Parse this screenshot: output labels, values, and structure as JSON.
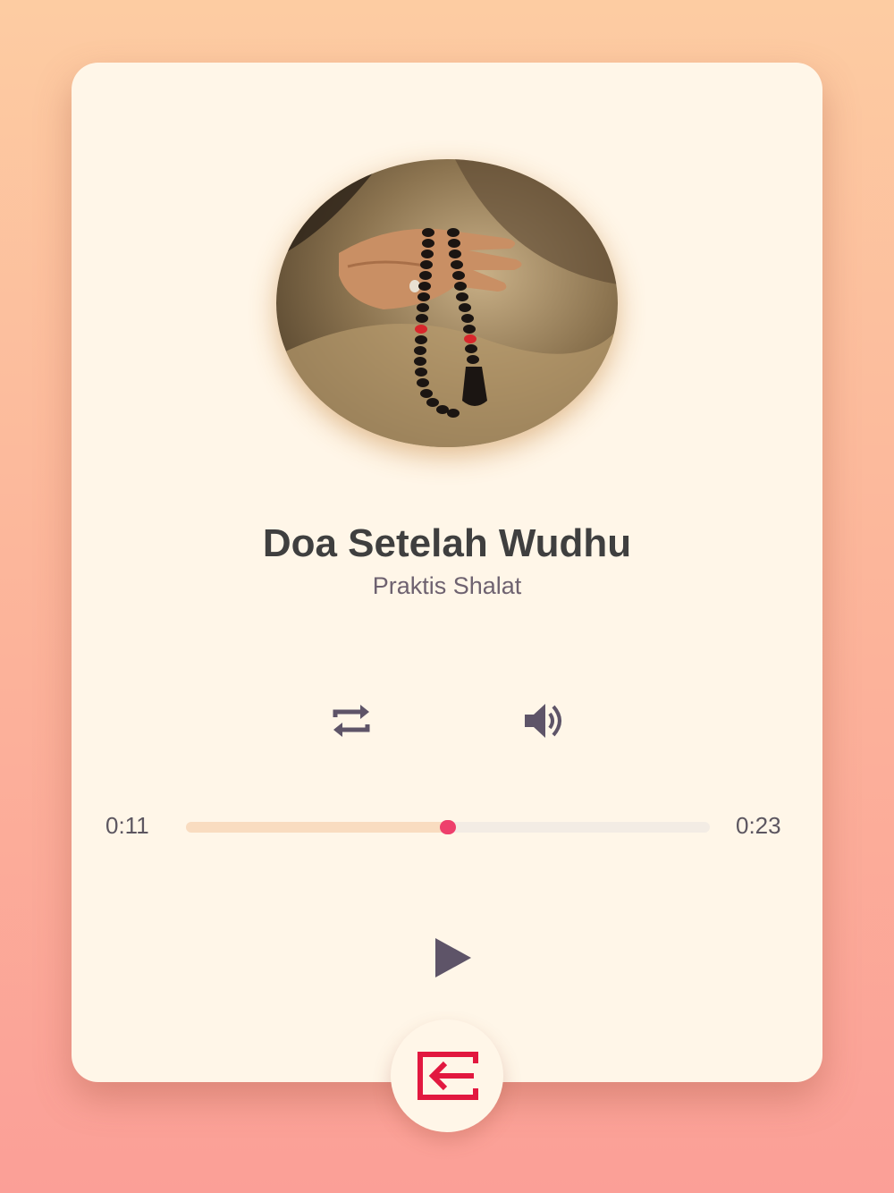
{
  "track": {
    "title": "Doa Setelah Wudhu",
    "artist": "Praktis Shalat",
    "artwork": "prayer-beads-hand-photo"
  },
  "controls": {
    "repeat_icon": "repeat-icon",
    "volume_icon": "volume-icon",
    "play_icon": "play-icon",
    "exit_icon": "exit-icon"
  },
  "progress": {
    "current_time": "0:11",
    "total_time": "0:23",
    "fraction": 0.5
  },
  "colors": {
    "accent": "#ee3f6c",
    "exit": "#e2183f",
    "icon": "#5e5468"
  }
}
